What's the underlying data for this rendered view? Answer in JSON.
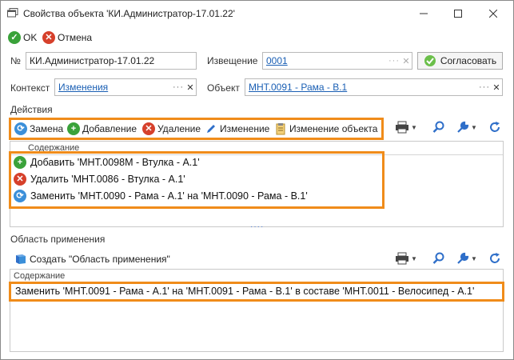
{
  "window": {
    "title": "Свойства объекта 'КИ.Администратор-17.01.22'"
  },
  "top_toolbar": {
    "ok_label": "OK",
    "cancel_label": "Отмена"
  },
  "fields": {
    "number_label": "№",
    "number_value": "КИ.Администратор-17.01.22",
    "notice_label": "Извещение",
    "notice_value": "0001",
    "approve_button": "Согласовать",
    "context_label": "Контекст",
    "context_value": "Изменения",
    "object_label": "Объект",
    "object_value": "МНТ.0091 - Рама - В.1"
  },
  "actions": {
    "section_title": "Действия",
    "toolbar": {
      "replace": "Замена",
      "add": "Добавление",
      "delete": "Удаление",
      "change": "Изменение",
      "change_object": "Изменение объекта"
    },
    "column_header": "Содержание",
    "rows": [
      {
        "type": "add",
        "text": "Добавить 'МНТ.0098М - Втулка - А.1'"
      },
      {
        "type": "delete",
        "text": "Удалить 'МНТ.0086 - Втулка - А.1'"
      },
      {
        "type": "replace",
        "text": "Заменить 'МНТ.0090 - Рама - А.1' на 'МНТ.0090 - Рама - В.1'"
      }
    ]
  },
  "scope": {
    "section_title": "Область применения",
    "create_label": "Создать \"Область применения\"",
    "column_header": "Содержание",
    "rows": [
      {
        "text": "Заменить 'МНТ.0091 - Рама - А.1' на 'МНТ.0091 - Рама - В.1' в составе 'МНТ.0011 - Велосипед - А.1'"
      }
    ]
  },
  "colors": {
    "highlight": "#f08c1a",
    "link": "#1a5fb4",
    "add_green": "#3aa23a",
    "delete_red": "#d6402b",
    "replace_blue": "#3b8fd9"
  }
}
